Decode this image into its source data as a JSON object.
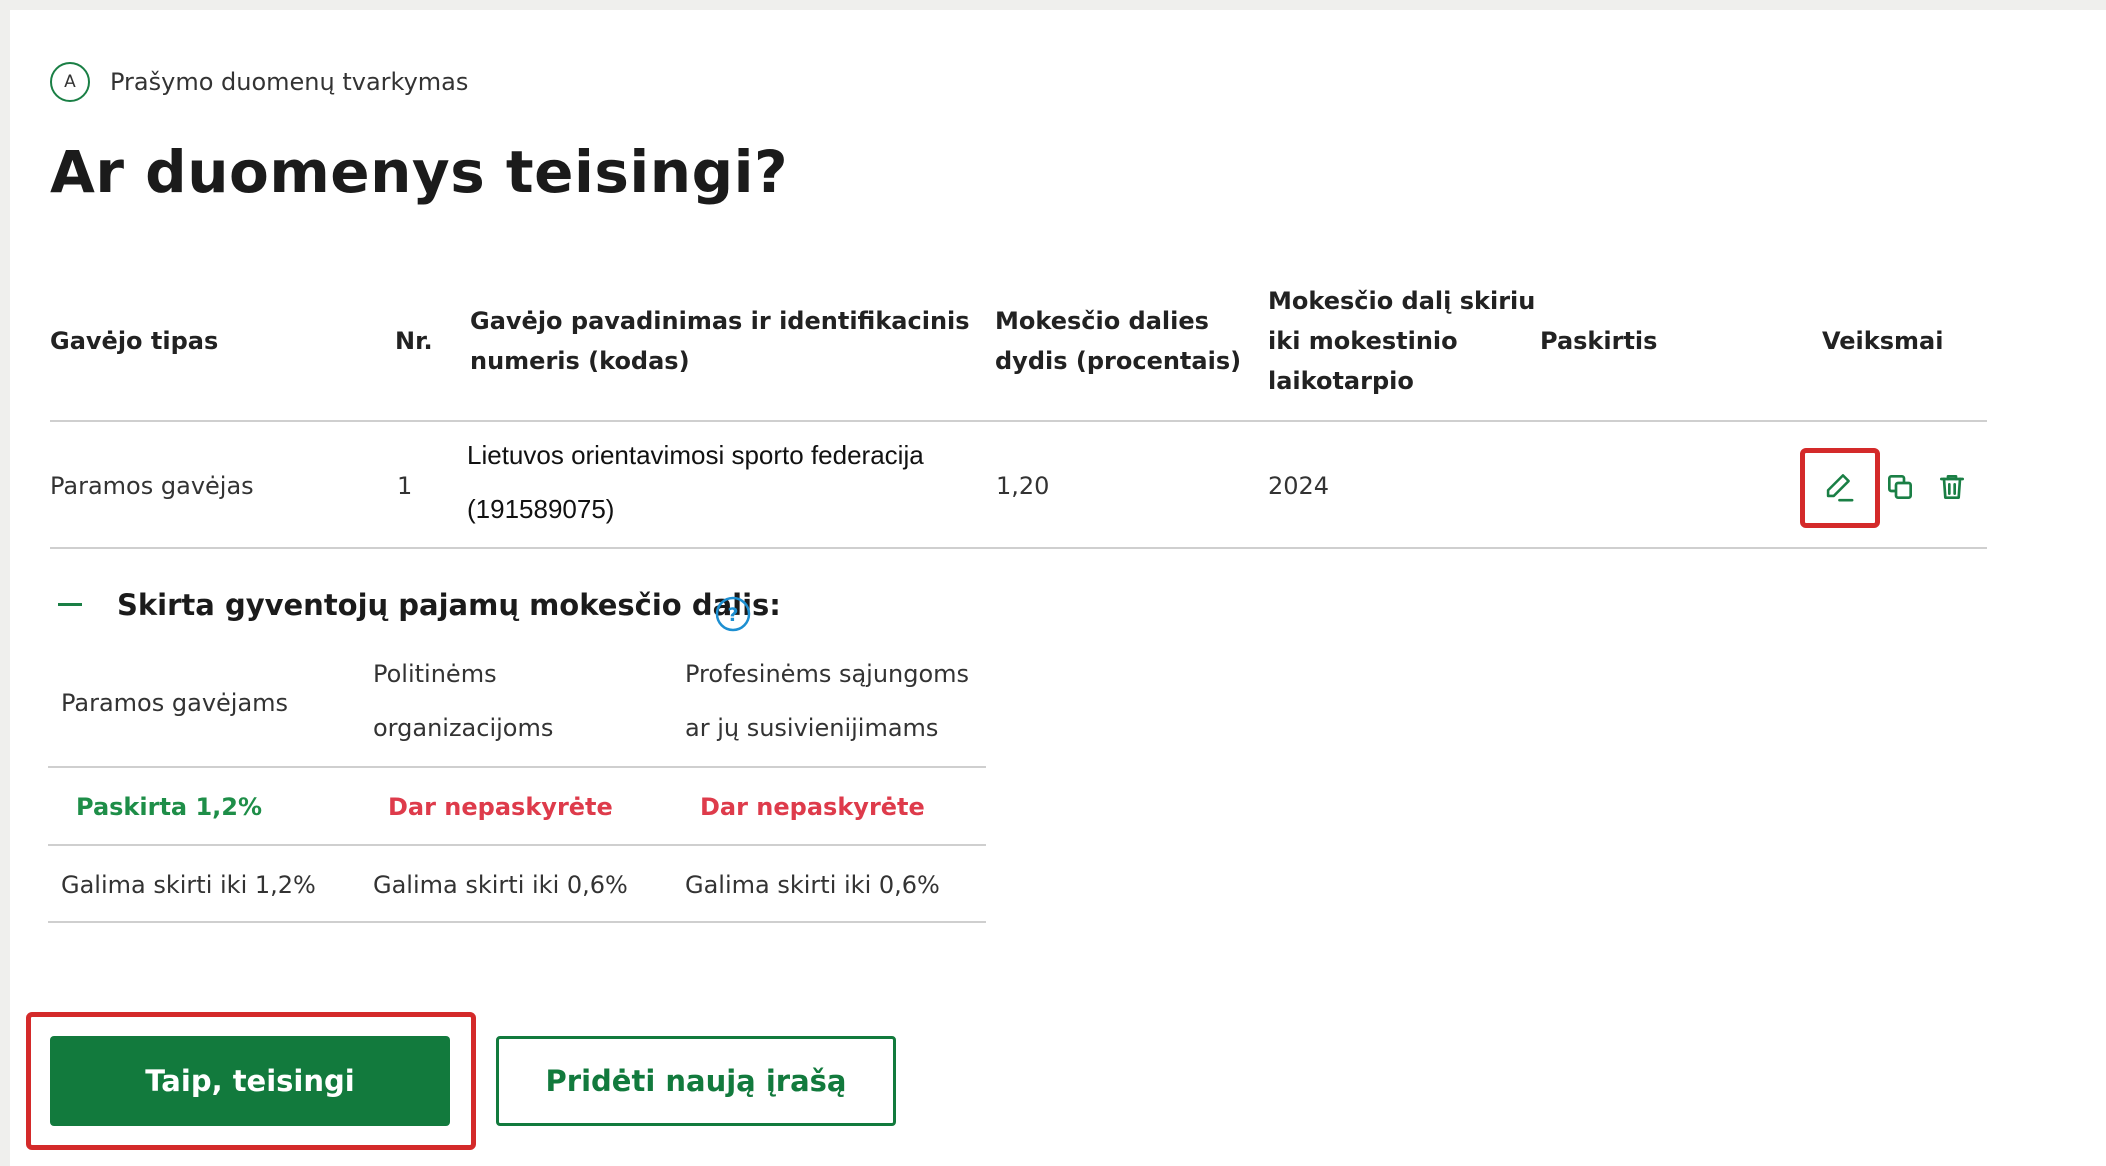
{
  "step": {
    "letter": "A",
    "label": "Prašymo duomenų tvarkymas"
  },
  "page_title": "Ar duomenys teisingi?",
  "table": {
    "headers": {
      "recipient_type": "Gavėjo tipas",
      "nr": "Nr.",
      "name_line1": "Gavėjo pavadinimas ir identifikacinis",
      "name_line2": "numeris (kodas)",
      "share_line1": "Mokesčio dalies",
      "share_line2": "dydis (procentais)",
      "period_line1": "Mokesčio dalį skiriu",
      "period_line2": "iki mokestinio",
      "period_line3": "laikotarpio",
      "purpose": "Paskirtis",
      "actions": "Veiksmai"
    },
    "rows": [
      {
        "recipient_type": "Paramos gavėjas",
        "nr": "1",
        "name_line1": "Lietuvos orientavimosi sporto federacija",
        "name_line2": "(191589075)",
        "share": "1,20",
        "period": "2024",
        "purpose": ""
      }
    ],
    "action_icons": [
      "edit-icon",
      "copy-icon",
      "trash-icon"
    ]
  },
  "allocation": {
    "title": "Skirta gyventojų pajamų mokesčio dalis:",
    "columns": [
      {
        "label_line1": "Paramos gavėjams",
        "label_line2": "",
        "status": "Paskirta 1,2%",
        "status_color": "#1e8e48",
        "limit": "Galima skirti iki 1,2%"
      },
      {
        "label_line1": "Politinėms",
        "label_line2": "organizacijoms",
        "status": "Dar nepaskyrėte",
        "status_color": "#de3b4b",
        "limit": "Galima skirti iki 0,6%"
      },
      {
        "label_line1": "Profesinėms sąjungoms",
        "label_line2": "ar jų susivienijimams",
        "status": "Dar nepaskyrėte",
        "status_color": "#de3b4b",
        "limit": "Galima skirti iki 0,6%"
      }
    ]
  },
  "buttons": {
    "confirm": "Taip, teisingi",
    "add_new": "Pridėti naują įrašą"
  },
  "colors": {
    "brand_green": "#127a3d",
    "highlight_red": "#d42a2a",
    "help_blue": "#1d8fd1"
  }
}
